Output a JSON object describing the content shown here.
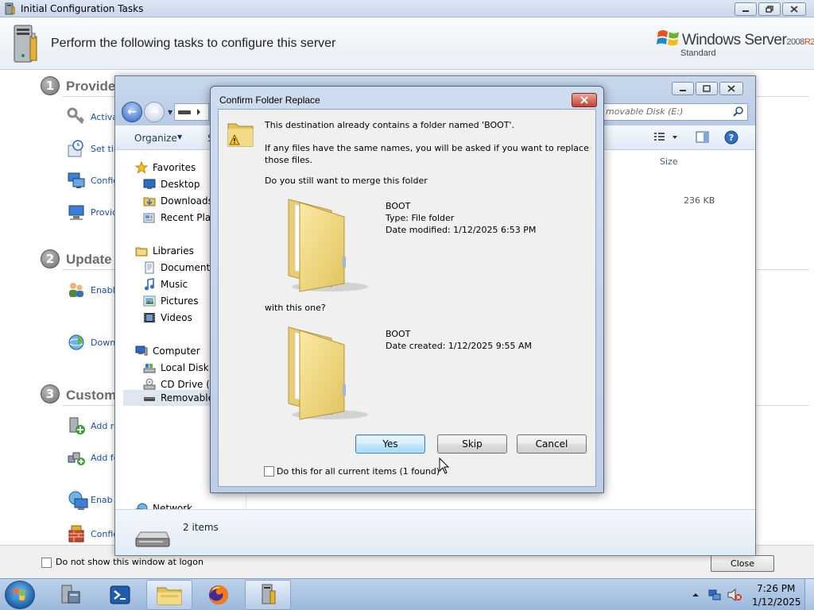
{
  "ict": {
    "window_title": "Initial Configuration Tasks",
    "header": "Perform the following tasks to configure this server",
    "brand": {
      "name": "Windows Server",
      "version": "2008",
      "release": "R2",
      "edition": "Standard"
    },
    "sections": [
      {
        "number": "1",
        "title": "Provide",
        "tasks": [
          {
            "label": "Activa",
            "icon": "key-icon"
          },
          {
            "label": "Set tim",
            "icon": "clock-icon"
          },
          {
            "label": "Config",
            "icon": "network-config-icon"
          },
          {
            "label": "Provid",
            "icon": "computer-name-icon"
          }
        ]
      },
      {
        "number": "2",
        "title": "Update",
        "tasks": [
          {
            "label": "Enable",
            "icon": "users-icon"
          },
          {
            "label": "Downl",
            "icon": "update-globe-icon"
          }
        ]
      },
      {
        "number": "3",
        "title": "Custom",
        "tasks": [
          {
            "label": "Add ro",
            "icon": "add-roles-icon"
          },
          {
            "label": "Add fe",
            "icon": "add-features-icon"
          },
          {
            "label": "Enab",
            "icon": "remote-desktop-icon"
          },
          {
            "label": "Config",
            "icon": "firewall-icon"
          }
        ]
      }
    ],
    "footer": {
      "checkbox_label": "Do not show this window at logon",
      "close_label": "Close"
    }
  },
  "explorer": {
    "search_placeholder": "movable Disk (E:)",
    "toolbar": {
      "organize": "Organize",
      "second": "S"
    },
    "nav": {
      "favorites": "Favorites",
      "desktop": "Desktop",
      "downloads": "Downloads",
      "recent": "Recent Plac",
      "libraries": "Libraries",
      "documents": "Documents",
      "music": "Music",
      "pictures": "Pictures",
      "videos": "Videos",
      "computer": "Computer",
      "local_disk": "Local Disk (",
      "cd_drive": "CD Drive (D",
      "removable": "Removable",
      "network": "Network"
    },
    "content": {
      "size_header": "Size",
      "size_value": "236 KB"
    },
    "details": {
      "items": "2 items"
    }
  },
  "dialog": {
    "title": "Confirm Folder Replace",
    "line1": "This destination already contains a folder named 'BOOT'.",
    "line2a": "If any files have the same names, you will be asked if you want to replace",
    "line2b": "those files.",
    "question": "Do you still want to merge this folder",
    "source": {
      "name": "BOOT",
      "type": "Type: File folder",
      "date": "Date modified: 1/12/2025 6:53 PM"
    },
    "with_this": "with this one?",
    "dest": {
      "name": "BOOT",
      "date": "Date created: 1/12/2025 9:55 AM"
    },
    "buttons": {
      "yes": "Yes",
      "skip": "Skip",
      "cancel": "Cancel"
    },
    "checkbox_label": "Do this for all current items (1 found)"
  },
  "taskbar": {
    "apps": [
      "server-manager-icon",
      "powershell-icon",
      "file-explorer-icon",
      "firefox-icon",
      "initial-config-icon"
    ],
    "time": "7:26 PM",
    "date": "1/12/2025"
  },
  "colors": {
    "link": "#1a4ea8",
    "section_title": "#6d6d6d",
    "accent": "#3c7fb1"
  }
}
